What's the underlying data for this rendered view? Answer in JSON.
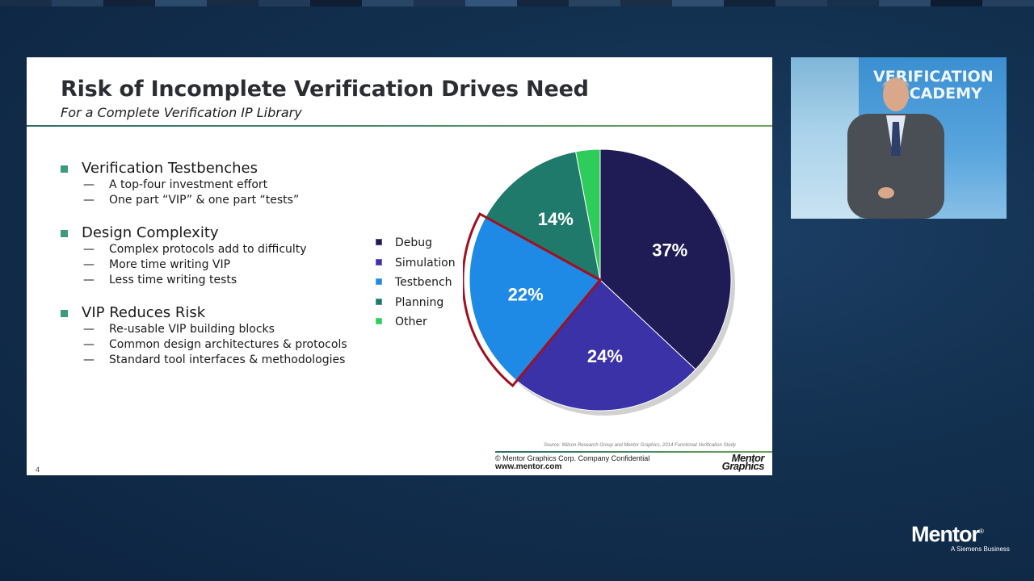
{
  "slide": {
    "title": "Risk of Incomplete Verification Drives Need",
    "subtitle": "For a Complete Verification IP Library",
    "bullets": [
      {
        "text": "Verification Testbenches",
        "subs": [
          "A top-four investment effort",
          "One part “VIP” & one part “tests”"
        ]
      },
      {
        "text": "Design Complexity",
        "subs": [
          "Complex protocols add to difficulty",
          "More time writing VIP",
          "Less time writing tests"
        ]
      },
      {
        "text": "VIP Reduces Risk",
        "subs": [
          "Re-usable VIP building blocks",
          "Common design architectures & protocols",
          "Standard tool interfaces & methodologies"
        ]
      }
    ],
    "source": "Source:  Wilson Research Group and Mentor Graphics, 2014 Functional Verification Study",
    "copyright": "© Mentor Graphics Corp. Company Confidential",
    "website": "www.mentor.com",
    "logo_line1": "Mentor",
    "logo_line2": "Graphics",
    "page_number": "4"
  },
  "chart_data": {
    "type": "pie",
    "categories": [
      "Debug",
      "Simulation",
      "Testbench",
      "Planning",
      "Other"
    ],
    "values": [
      37,
      24,
      22,
      14,
      3
    ],
    "labels": [
      "37%",
      "24%",
      "22%",
      "14%",
      ""
    ],
    "colors": [
      "#1f1b55",
      "#3a32a6",
      "#1f8ae6",
      "#1f7a6c",
      "#2ecc5a"
    ],
    "highlighted": "Testbench",
    "highlight_color": "#a01020",
    "legend_position": "left"
  },
  "video": {
    "banner_line1": "VERIFICATION",
    "banner_line2": "ACADEMY"
  },
  "branding": {
    "logo": "Mentor",
    "tagline": "A Siemens Business"
  }
}
